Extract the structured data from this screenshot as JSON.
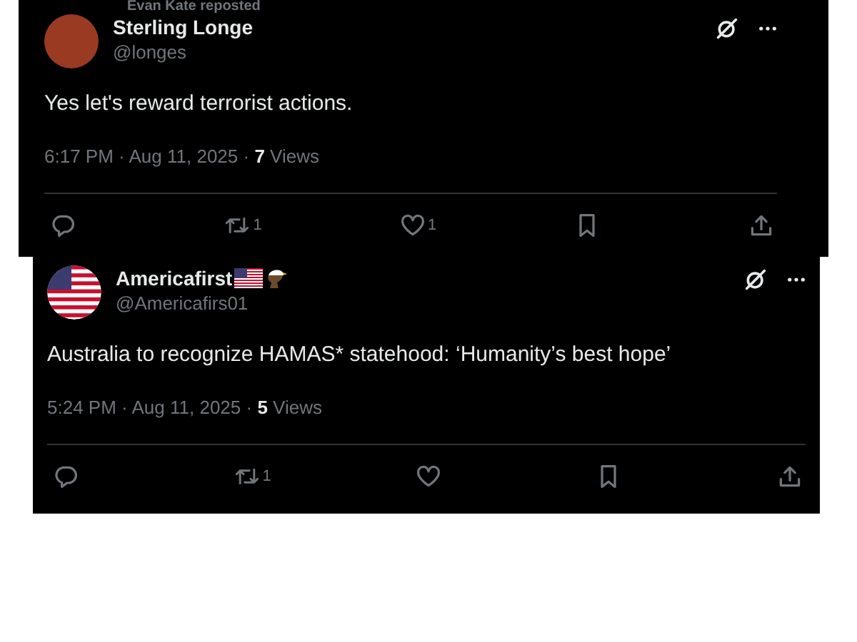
{
  "tweets": [
    {
      "reposted_by": "Evan Kate reposted",
      "avatar": {
        "kind": "photo"
      },
      "name": "Sterling Longe",
      "handle": "@longes",
      "text": "Yes let's reward terrorist actions.",
      "meta": "6:17 PM · Aug 11, 2025 · **7** Views",
      "actions": {
        "reposts": "1",
        "likes": "1"
      }
    },
    {
      "avatar": {
        "kind": "flag"
      },
      "name": "Americafirst",
      "flag_emoji": true,
      "eagle_emoji": true,
      "handle": "@Americafirs01",
      "text": "Australia to recognize HAMAS* statehood: ‘Humanity’s best hope’",
      "meta": "5:24 PM · Aug 11, 2025 · **5** Views",
      "actions": {
        "reposts": "1"
      }
    }
  ]
}
